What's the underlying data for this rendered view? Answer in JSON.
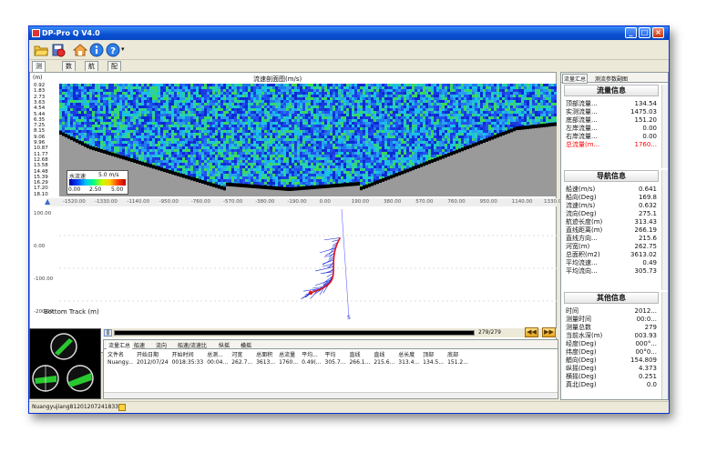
{
  "window": {
    "title": "DP-Pro Q V4.0"
  },
  "main_tabs": [
    {
      "label": "测流控制"
    },
    {
      "label": "数据"
    },
    {
      "label": "航迹"
    },
    {
      "label": "配置"
    }
  ],
  "profile": {
    "title": "流速剖面图(m/s)",
    "unit": "(m)",
    "depth_ticks": [
      "0.92",
      "1.83",
      "2.73",
      "3.63",
      "4.54",
      "5.44",
      "6.35",
      "7.25",
      "8.15",
      "9.06",
      "9.96",
      "10.87",
      "11.77",
      "12.68",
      "13.58",
      "14.48",
      "15.39",
      "16.29",
      "17.20",
      "18.10"
    ],
    "x_ticks": [
      "-1520.00",
      "-1330.00",
      "-1140.00",
      "-950.00",
      "-760.00",
      "-570.00",
      "-380.00",
      "-190.00",
      "0.00",
      "190.00",
      "380.00",
      "570.00",
      "760.00",
      "950.00",
      "1140.00",
      "1330.0"
    ],
    "legend": {
      "label": "水流速",
      "max_label": "5.0 m/s",
      "ticks": [
        "0.00",
        "2.50",
        "5.00"
      ]
    }
  },
  "track": {
    "y_ticks": [
      "100.00",
      "0.00",
      "-100.00",
      "-200.00"
    ],
    "label": "Bottom Track (m)",
    "start_marker": "S"
  },
  "progress": {
    "text": "279/279",
    "fraction": 1.0
  },
  "bottom_tabs": [
    {
      "label": "流量汇总"
    },
    {
      "label": "船速"
    },
    {
      "label": "流向"
    },
    {
      "label": "船速/流速比"
    },
    {
      "label": "纵摇"
    },
    {
      "label": "横摇"
    }
  ],
  "table": {
    "headers": [
      "文件名",
      "开始日期",
      "开始时间",
      "总测...",
      "河宽",
      "总面积",
      "总流量",
      "平均...",
      "平均",
      "直线",
      "直线",
      "总长度",
      "顶部",
      "底部"
    ],
    "rows": [
      [
        "Nuangy...",
        "2012/07/24",
        "0018:35:33",
        "00:04...",
        "262.7...",
        "3613...",
        "1760...",
        "0.49(...",
        "305.7...",
        "266.1...",
        "215.6...",
        "313.4...",
        "134.5...",
        "151.2..."
      ]
    ]
  },
  "right_tabs": [
    {
      "label": "流量汇总"
    },
    {
      "label": "测流参数副图"
    }
  ],
  "flow_info": {
    "title": "流量信息",
    "items": [
      {
        "k": "顶部流量...",
        "v": "134.54"
      },
      {
        "k": "实测流量...",
        "v": "1475.03"
      },
      {
        "k": "底部流量...",
        "v": "151.20"
      },
      {
        "k": "左岸流量...",
        "v": "0.00"
      },
      {
        "k": "右岸流量...",
        "v": "0.00"
      },
      {
        "k": "总流量(m...",
        "v": "1760..."
      }
    ]
  },
  "nav_info": {
    "title": "导航信息",
    "items": [
      {
        "k": "船速(m/s)",
        "v": "0.641"
      },
      {
        "k": "船向(Deg)",
        "v": "169.8"
      },
      {
        "k": "流速(m/s)",
        "v": "0.632"
      },
      {
        "k": "流向(Deg)",
        "v": "275.1"
      },
      {
        "k": "航迹长度(m)",
        "v": "313.43"
      },
      {
        "k": "直线距离(m)",
        "v": "266.19"
      },
      {
        "k": "直线方向...",
        "v": "215.6"
      },
      {
        "k": "河宽(m)",
        "v": "262.75"
      },
      {
        "k": "总面积(m2)",
        "v": "3613.02"
      },
      {
        "k": "平均流速...",
        "v": "0.49"
      },
      {
        "k": "平均流向...",
        "v": "305.73"
      }
    ]
  },
  "other_info": {
    "title": "其他信息",
    "items": [
      {
        "k": "时间",
        "v": "2012..."
      },
      {
        "k": "测量时间",
        "v": "00:0..."
      },
      {
        "k": "测量总数",
        "v": "279"
      },
      {
        "k": "当前水深(m)",
        "v": "003.93"
      },
      {
        "k": "经度(Deg)",
        "v": "000°..."
      },
      {
        "k": "纬度(Deg)",
        "v": "00°0..."
      },
      {
        "k": "艏向(Deg)",
        "v": "154.809"
      },
      {
        "k": "纵摇(Deg)",
        "v": "4.373"
      },
      {
        "k": "横摇(Deg)",
        "v": "0.251"
      },
      {
        "k": "真北(Deg)",
        "v": "0.0"
      }
    ]
  },
  "status": {
    "file": "Nuangyujiang8120120724183340"
  },
  "colors": {
    "titlebar": "#0a4fd0",
    "highlight": "#ff0000",
    "track_line": "#e0141c",
    "track_vectors": "#1a2dd8"
  },
  "icons": [
    "open-folder-icon",
    "save-icon",
    "home-icon",
    "info-icon",
    "help-icon"
  ]
}
